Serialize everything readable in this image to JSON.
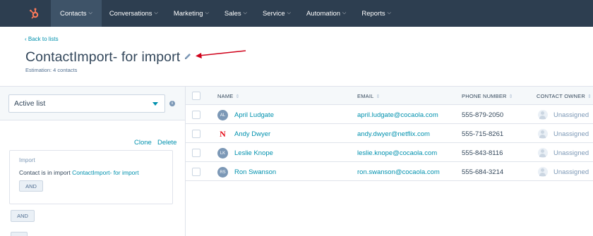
{
  "nav": {
    "items": [
      {
        "label": "Contacts",
        "active": true
      },
      {
        "label": "Conversations"
      },
      {
        "label": "Marketing"
      },
      {
        "label": "Sales"
      },
      {
        "label": "Service"
      },
      {
        "label": "Automation"
      },
      {
        "label": "Reports"
      }
    ],
    "chevron": "⌵",
    "logo_icon": "hubspot-sprocket-icon"
  },
  "header": {
    "back_label": "‹  Back to lists",
    "title": "ContactImport- for import",
    "estimation": "Estimation: 4 contacts"
  },
  "left_panel": {
    "list_type": "Active list",
    "clone_label": "Clone",
    "delete_label": "Delete",
    "filter": {
      "title": "Import",
      "text_prefix": "Contact is in import ",
      "text_link": "ContactImport- for import",
      "and_label": "AND"
    },
    "and_label": "AND"
  },
  "table": {
    "columns": {
      "name": "NAME",
      "email": "EMAIL",
      "phone": "PHONE NUMBER",
      "owner": "CONTACT OWNER"
    },
    "sort_glyph": "⇕",
    "rows": [
      {
        "initials": "AL",
        "name": "April Ludgate",
        "email": "april.ludgate@cocaola.com",
        "phone": "555-879-2050",
        "owner": "Unassigned"
      },
      {
        "initials": "N",
        "name": "Andy Dwyer",
        "email": "andy.dwyer@netflix.com",
        "phone": "555-715-8261",
        "owner": "Unassigned"
      },
      {
        "initials": "LK",
        "name": "Leslie Knope",
        "email": "leslie.knope@cocaola.com",
        "phone": "555-843-8116",
        "owner": "Unassigned"
      },
      {
        "initials": "RS",
        "name": "Ron Swanson",
        "email": "ron.swanson@cocaola.com",
        "phone": "555-684-3214",
        "owner": "Unassigned"
      }
    ]
  },
  "colors": {
    "nav_bg": "#2d3e50",
    "link": "#0091ae",
    "brand_orange": "#ff7a59",
    "arrow_red": "#d0021b",
    "netflix_red": "#e50914"
  }
}
